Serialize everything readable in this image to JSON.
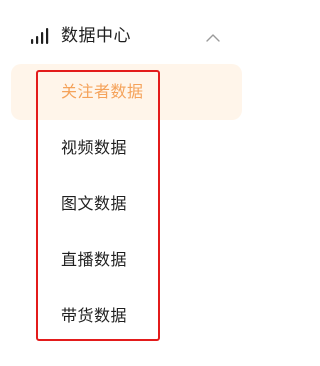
{
  "header": {
    "label": "数据中心",
    "icon": "bar-chart-icon",
    "chevron_icon": "chevron-up-icon",
    "expanded": true
  },
  "menu": {
    "items": [
      {
        "label": "关注者数据",
        "active": true
      },
      {
        "label": "视频数据",
        "active": false
      },
      {
        "label": "图文数据",
        "active": false
      },
      {
        "label": "直播数据",
        "active": false
      },
      {
        "label": "带货数据",
        "active": false
      }
    ]
  },
  "colors": {
    "active_text": "#f5a35b",
    "active_bg": "#fff5ea",
    "text": "#1f1f1f",
    "highlight_border": "#e31b1b"
  }
}
